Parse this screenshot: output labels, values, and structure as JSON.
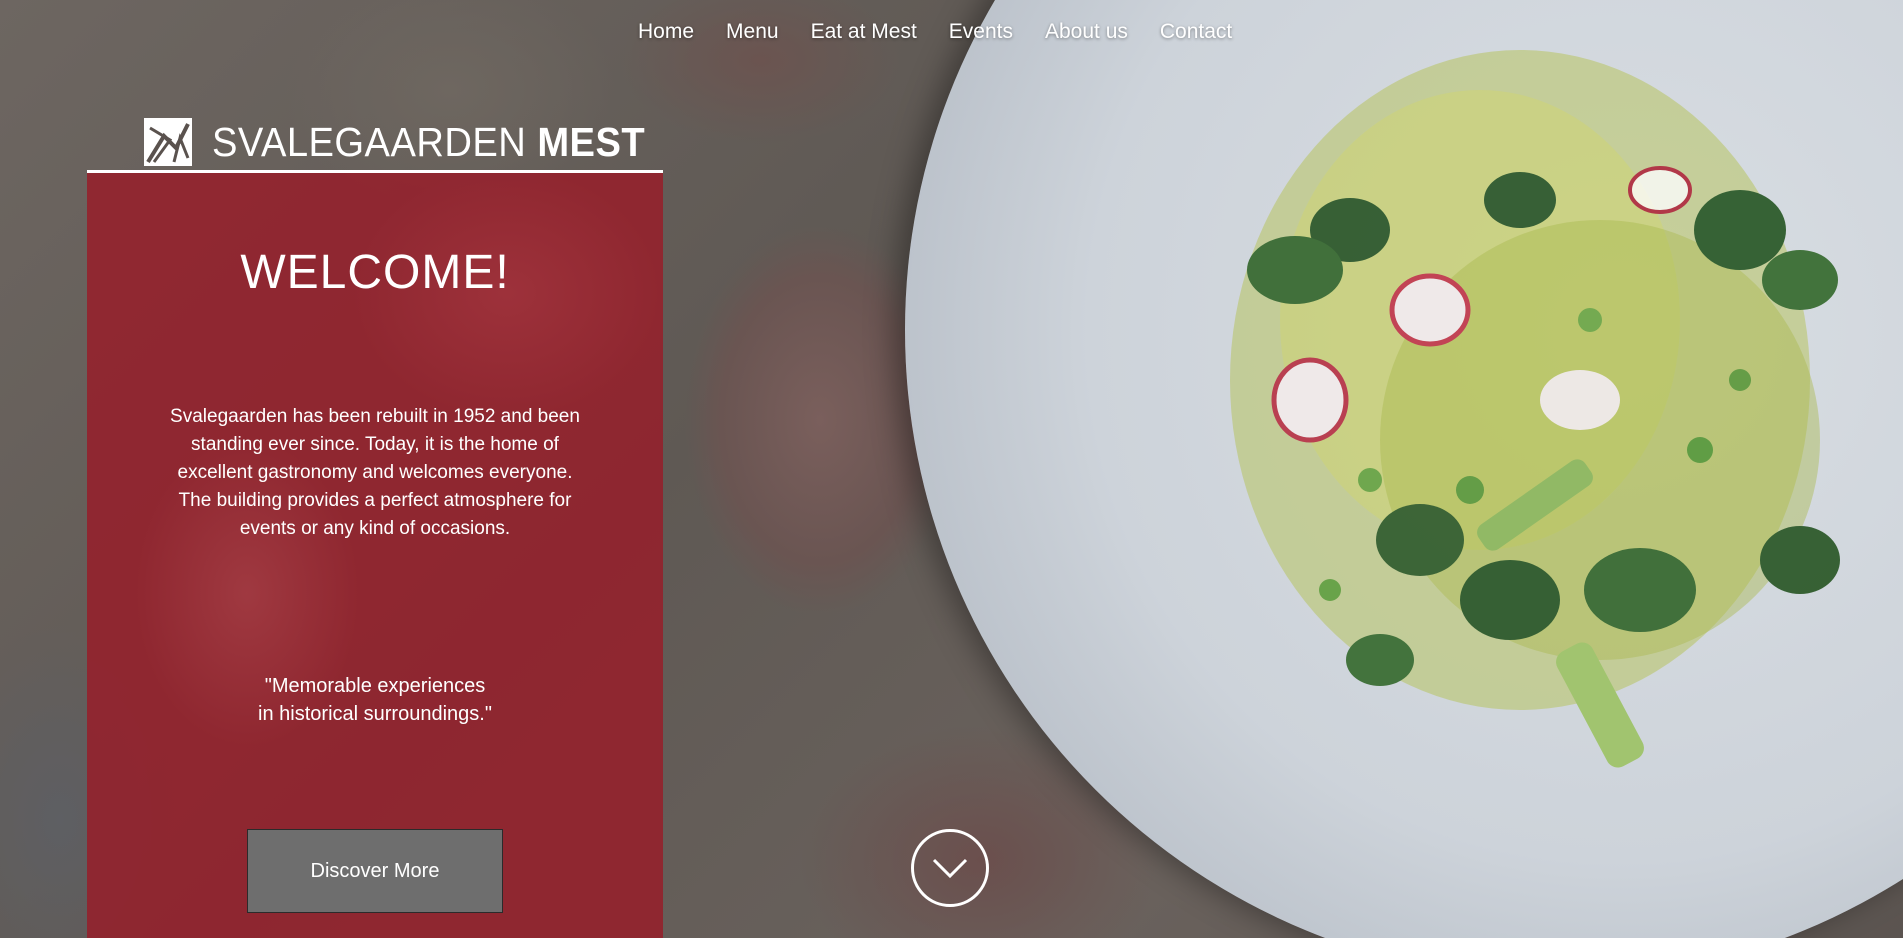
{
  "nav": {
    "items": [
      "Home",
      "Menu",
      "Eat at Mest",
      "Events",
      "About us",
      "Contact"
    ]
  },
  "logo": {
    "icon": "logo-mark",
    "name_light": "SVALEGAARDEN",
    "name_bold": "MEST"
  },
  "panel": {
    "heading": "WELCOME!",
    "intro": "Svalegaarden has been rebuilt in 1952 and been standing ever since. Today, it is the home of excellent gastronomy and welcomes everyone. The building provides a perfect atmosphere for events or any kind of occasions.",
    "quote_line1": "\"Memorable experiences",
    "quote_line2": "in historical surroundings.\"",
    "button_label": "Discover More",
    "color": "#961e2a"
  },
  "scroll": {
    "icon": "chevron-down-icon"
  },
  "colors": {
    "text": "#ffffff",
    "button_bg": "#6e6e6e"
  }
}
